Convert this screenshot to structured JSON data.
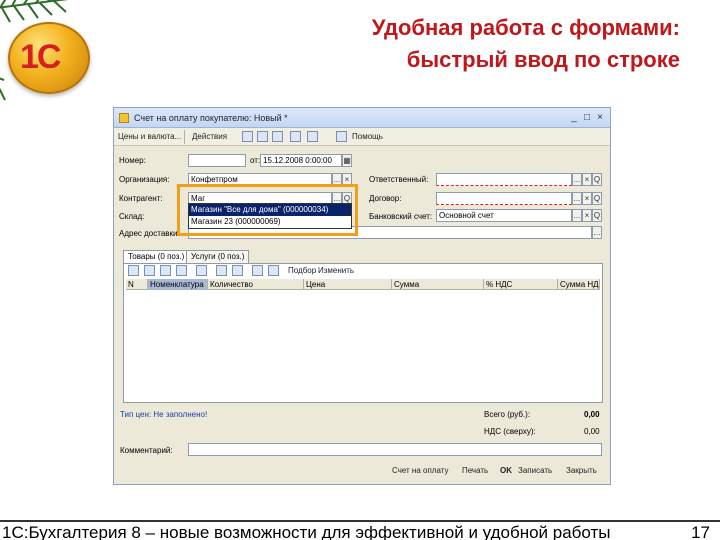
{
  "slide": {
    "title_line1": "Удобная работа с формами:",
    "title_line2": "быстрый ввод по строке",
    "logo_text": "1С",
    "footer_text": "1С:Бухгалтерия 8 – новые возможности для эффективной и удобной работы",
    "page_number": "17"
  },
  "window": {
    "title": "Счет на оплату покупателю: Новый *",
    "controls": [
      "_",
      "□",
      "×"
    ],
    "toolbar": {
      "prices_label": "Цены и валюта...",
      "actions_label": "Действия",
      "help_label": "Помощь"
    },
    "form": {
      "number_label": "Номер:",
      "number_value": "",
      "date_label": "от:",
      "date_value": "15.12.2008 0:00:00",
      "org_label": "Организация:",
      "org_value": "Конфетпром",
      "contractor_label": "Контрагент:",
      "contractor_value": "Маг",
      "warehouse_label": "Склад:",
      "warehouse_value": "",
      "address_label": "Адрес доставки:",
      "address_value": "",
      "responsible_label": "Ответственный:",
      "responsible_value": "",
      "contract_label": "Договор:",
      "contract_value": "",
      "bank_label": "Банковский счет:",
      "bank_value": "Основной счет",
      "select_btn": "...",
      "open_btn": "Q",
      "clear_btn": "×"
    },
    "dropdown": {
      "items": [
        "Магазин \"Все для дома\" (000000034)",
        "Магазин 23 (000000069)"
      ]
    },
    "tabs": [
      "Товары (0 поз.)",
      "Услуги (0 поз.)"
    ],
    "table_toolbar": {
      "pick_label": "Подбор",
      "change_label": "Изменить"
    },
    "columns": [
      "N",
      "Номенклатура",
      "Количество",
      "Цена",
      "Сумма",
      "% НДС",
      "Сумма НДС"
    ],
    "totals": {
      "price_type_label": "Тип цен: Не заполнено!",
      "total_label": "Всего (руб.):",
      "total_value": "0,00",
      "vat_label": "НДС (сверху):",
      "vat_value": "0,00"
    },
    "comment_label": "Комментарий:",
    "comment_value": "",
    "bottom_buttons": [
      "Счет на оплату",
      "Печать",
      "OK",
      "Записать",
      "Закрыть"
    ]
  }
}
